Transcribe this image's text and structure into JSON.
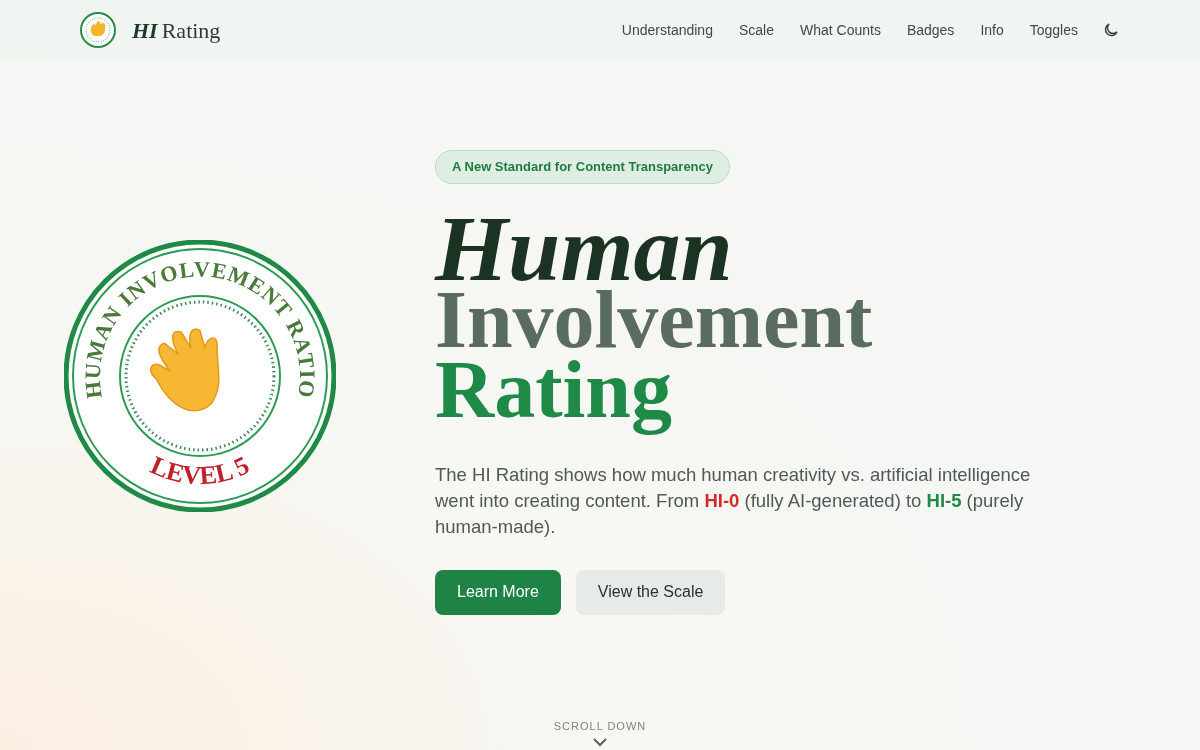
{
  "header": {
    "logo_italic": "HI",
    "logo_text": "Rating",
    "nav": [
      "Understanding",
      "Scale",
      "What Counts",
      "Badges",
      "Info",
      "Toggles"
    ]
  },
  "badge": {
    "ring_text": "HUMAN INVOLVEMENT RATIO",
    "level_text": "LEVEL 5"
  },
  "hero": {
    "tag": "A New Standard for Content Transparency",
    "title": [
      {
        "text": "Human",
        "kind": "italic"
      },
      {
        "text": "Involvement",
        "kind": "muted"
      },
      {
        "text": "Rating",
        "kind": "accent"
      }
    ],
    "description": "The HI Rating shows how much human creativity vs. artificial intelligence went into creating content. From **HI-0** (fully AI-generated) to **HI-5** (purely human-made).",
    "buttons": [
      {
        "label": "Learn More",
        "kind": "primary"
      },
      {
        "label": "View the Scale",
        "kind": "secondary"
      }
    ]
  },
  "scroll_hint": "SCROLL DOWN"
}
